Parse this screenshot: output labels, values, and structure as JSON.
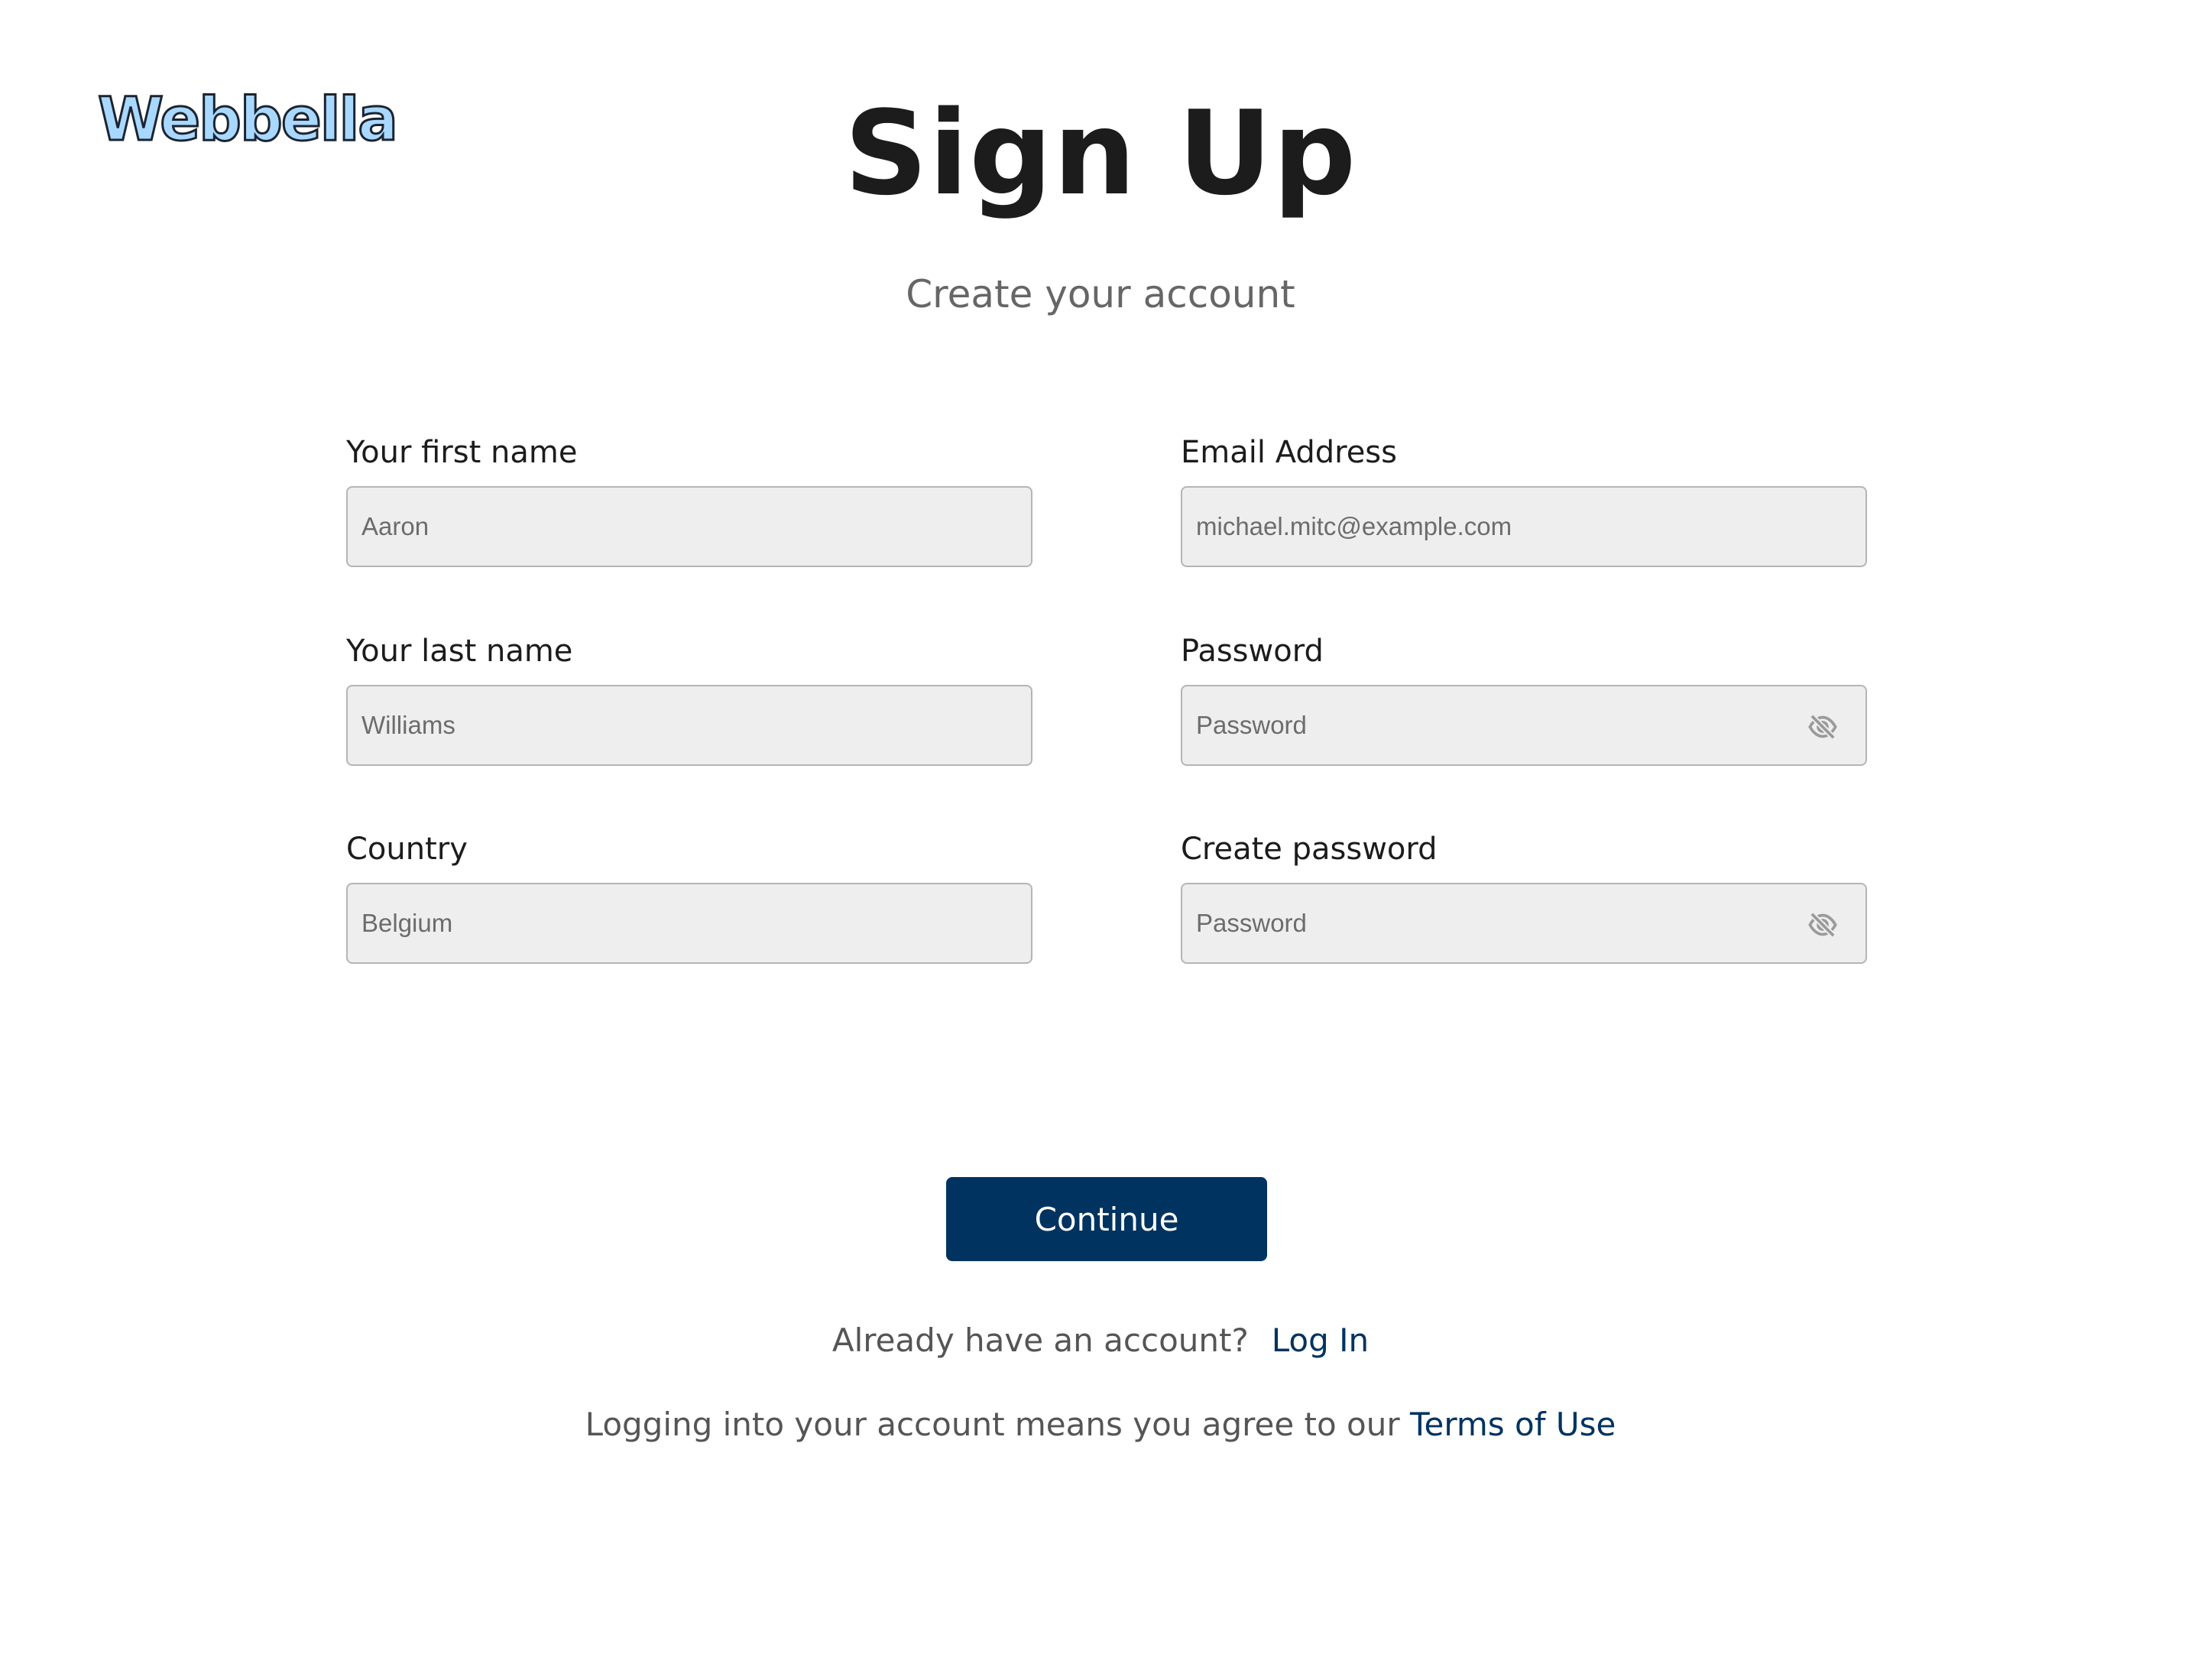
{
  "brand": {
    "logo_text": "Webbella"
  },
  "header": {
    "title": "Sign Up",
    "subtitle": "Create your account"
  },
  "form": {
    "first_name": {
      "label": "Your first name",
      "value": "Aaron"
    },
    "last_name": {
      "label": "Your last name",
      "value": "Williams"
    },
    "country": {
      "label": "Country",
      "value": "Belgium"
    },
    "email": {
      "label": "Email Address",
      "value": "michael.mitc@example.com"
    },
    "password": {
      "label": "Password",
      "placeholder": "Password",
      "icon": "eye-slash-icon"
    },
    "create_password": {
      "label": "Create password",
      "placeholder": "Password",
      "icon": "eye-slash-icon"
    }
  },
  "actions": {
    "continue_label": "Continue"
  },
  "footer": {
    "login_prompt": "Already have an account?",
    "login_link": "Log In",
    "terms_prefix": "Logging into your account means you agree to our",
    "terms_link": "Terms of Use"
  },
  "colors": {
    "primary": "#003360",
    "field_bg": "#eeeeee",
    "field_border": "#b5b5b5",
    "logo_fill": "#a8d8ff"
  }
}
